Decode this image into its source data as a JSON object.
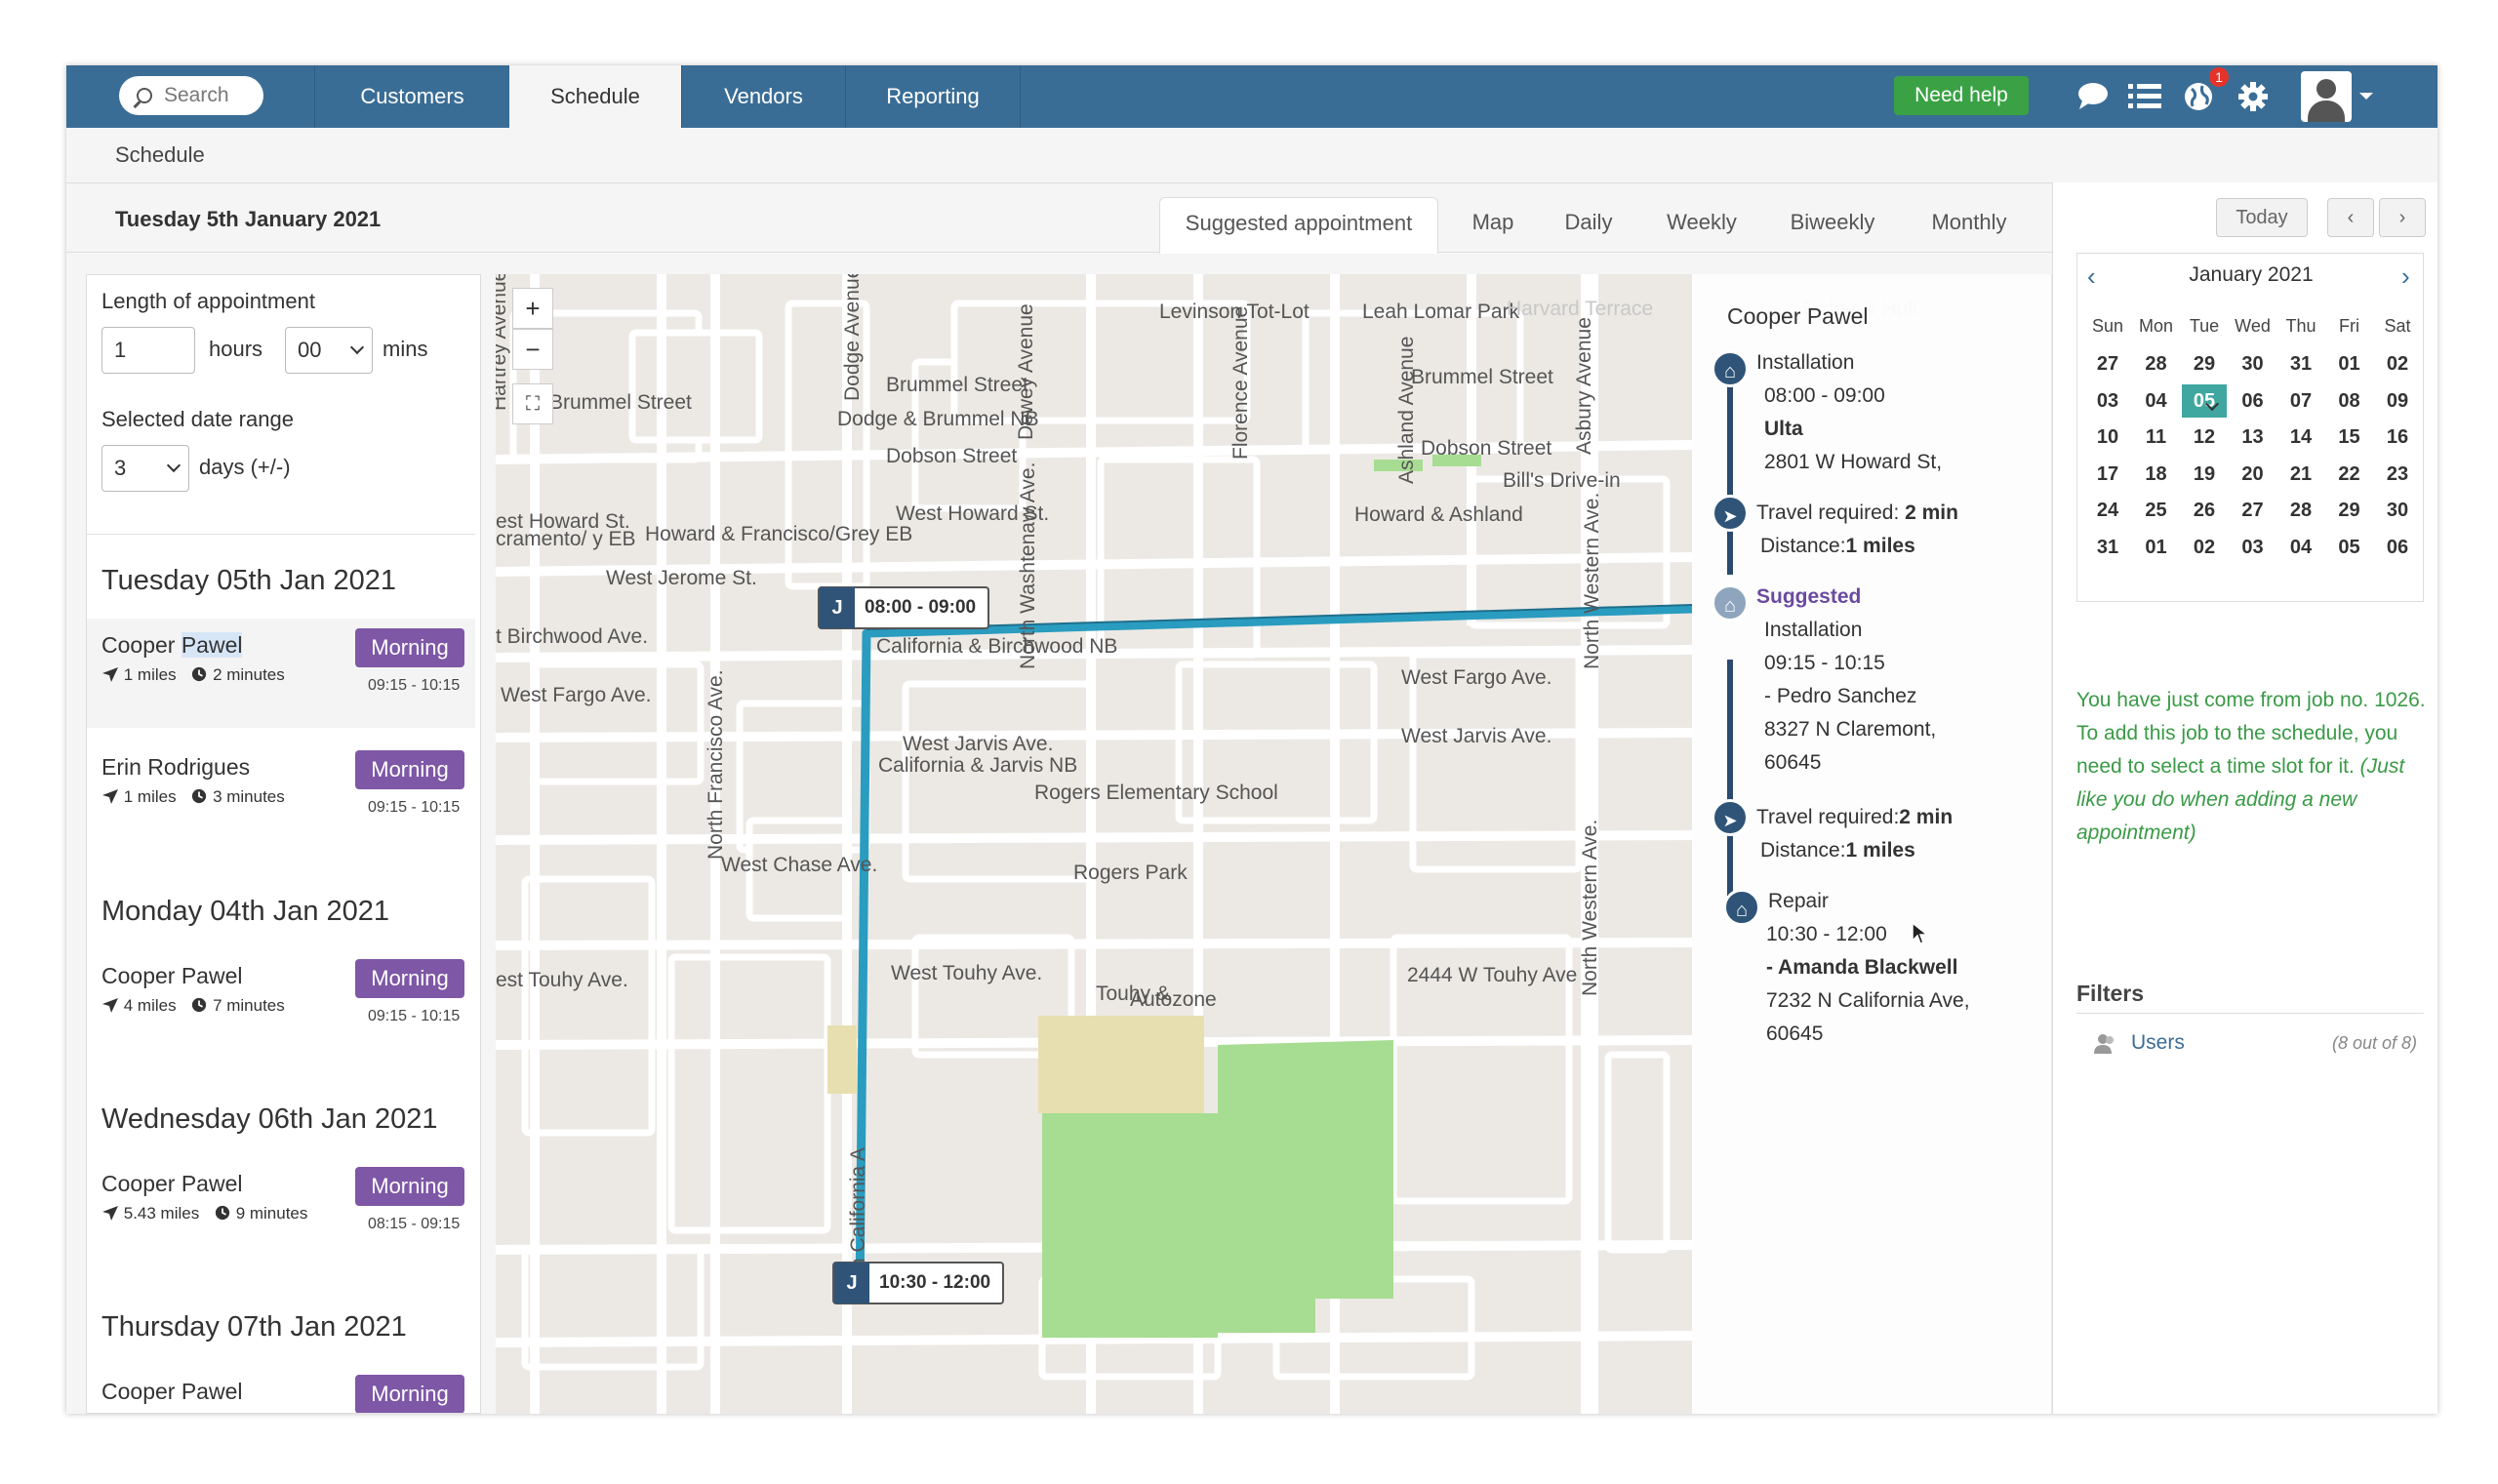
{
  "nav": {
    "search_placeholder": "Search",
    "tabs": [
      {
        "label": "Customers"
      },
      {
        "label": "Schedule"
      },
      {
        "label": "Vendors"
      },
      {
        "label": "Reporting"
      }
    ],
    "help_label": "Need help",
    "notification_count": "1"
  },
  "breadcrumb": "Schedule",
  "header": {
    "date_title": "Tuesday 5th January 2021",
    "view_tabs": [
      "Suggested appointment",
      "Map",
      "Daily",
      "Weekly",
      "Biweekly",
      "Monthly"
    ]
  },
  "form": {
    "length_label": "Length of appointment",
    "hours_value": "1",
    "hours_label": "hours",
    "mins_value": "00",
    "mins_label": "mins",
    "range_label": "Selected date range",
    "range_value": "3",
    "range_suffix": "days (+/-)"
  },
  "days": [
    {
      "title": "Tuesday 05th Jan 2021",
      "slots": [
        {
          "name_first": "Cooper ",
          "name_hi": "Pawel",
          "miles": "1 miles",
          "minutes": "2 minutes",
          "badge": "Morning",
          "time": "09:15 - 10:15"
        },
        {
          "name_first": "Erin Rodrigues",
          "name_hi": "",
          "miles": "1 miles",
          "minutes": "3 minutes",
          "badge": "Morning",
          "time": "09:15 - 10:15"
        }
      ]
    },
    {
      "title": "Monday 04th Jan 2021",
      "slots": [
        {
          "name_first": "Cooper Pawel",
          "name_hi": "",
          "miles": "4 miles",
          "minutes": "7 minutes",
          "badge": "Morning",
          "time": "09:15 - 10:15"
        }
      ]
    },
    {
      "title": "Wednesday 06th Jan 2021",
      "slots": [
        {
          "name_first": "Cooper Pawel",
          "name_hi": "",
          "miles": "5.43 miles",
          "minutes": "9 minutes",
          "badge": "Morning",
          "time": "08:15 - 09:15"
        }
      ]
    },
    {
      "title": "Thursday 07th Jan 2021",
      "slots": [
        {
          "name_first": "Cooper Pawel",
          "name_hi": "",
          "miles": "",
          "minutes": "",
          "badge": "Morning",
          "time": ""
        }
      ]
    }
  ],
  "map": {
    "labels": [
      "Levinson Tot-Lot",
      "Leah Lomar Park",
      "Brummel Street",
      "Brummel Street",
      "Brummel Street",
      "Dodge & Brummel NB",
      "Dobson Street",
      "Dobson Street",
      "Dodge Avenue",
      "Dewey Avenue",
      "Florence Avenue",
      "Ashland Avenue",
      "Asbury Avenue",
      "Hartrey Avenue",
      "Bill's Drive-in",
      "est Howard St.",
      "West Howard St.",
      "Howard & Ashland",
      "Howard & Francisco/Grey EB",
      "cramento/ y EB",
      "West Jerome St.",
      "t Birchwood Ave.",
      "California & Birchwood NB",
      "North Washtenaw Ave.",
      "North Western Ave.",
      "West Fargo Ave.",
      "West Fargo Ave.",
      "West Jarvis Ave.",
      "West Jarvis Ave.",
      "California & Jarvis NB",
      "North Francisco Ave.",
      "Rogers Elementary School",
      "Rogers Park",
      "West Chase Ave.",
      "est Touhy Ave.",
      "West Touhy Ave.",
      "2444 W Touhy Ave",
      "Touhy &",
      "Autozone",
      "h California A",
      "North Western Ave.",
      "Harvard Terrace",
      "Ridge & Hull"
    ],
    "marker1": {
      "letter": "J",
      "time": "08:00 - 09:00"
    },
    "marker2": {
      "letter": "J",
      "time": "10:30 - 12:00"
    }
  },
  "route": {
    "title": "Cooper Pawel",
    "stop1": {
      "type": "Installation",
      "time": "08:00 - 09:00",
      "name": "Ulta",
      "address": "2801 W Howard St,"
    },
    "travel1": {
      "label": "Travel required: ",
      "value": "2 min",
      "dist_label": "Distance:",
      "dist_value": "1 miles"
    },
    "suggested": {
      "label": "Suggested",
      "type": "Installation",
      "time": "09:15 - 10:15",
      "name": "- Pedro Sanchez",
      "address1": "8327 N Claremont,",
      "address2": "60645"
    },
    "travel2": {
      "label": "Travel required:",
      "value": "2 min",
      "dist_label": "Distance:",
      "dist_value": "1 miles"
    },
    "stop3": {
      "type": "Repair",
      "time": "10:30 - 12:00",
      "name": "- Amanda Blackwell",
      "address1": "7232 N California Ave,",
      "address2": "60645"
    }
  },
  "calendar": {
    "today_label": "Today",
    "month": "January 2021",
    "dow": [
      "Sun",
      "Mon",
      "Tue",
      "Wed",
      "Thu",
      "Fri",
      "Sat"
    ],
    "weeks": [
      [
        "27",
        "28",
        "29",
        "30",
        "31",
        "01",
        "02"
      ],
      [
        "03",
        "04",
        "05",
        "06",
        "07",
        "08",
        "09"
      ],
      [
        "10",
        "11",
        "12",
        "13",
        "14",
        "15",
        "16"
      ],
      [
        "17",
        "18",
        "19",
        "20",
        "21",
        "22",
        "23"
      ],
      [
        "24",
        "25",
        "26",
        "27",
        "28",
        "29",
        "30"
      ],
      [
        "31",
        "01",
        "02",
        "03",
        "04",
        "05",
        "06"
      ]
    ],
    "selected": "05"
  },
  "info": {
    "text": "You have just come from job no. 1026. To add this job to the schedule, you need to select a time slot for it. ",
    "italic": "(Just like you do when adding a new appointment)"
  },
  "filters": {
    "title": "Filters",
    "users_label": "Users",
    "users_count": "(8 out of 8)"
  },
  "colors": {
    "nav": "#3a6d96",
    "accent_green": "#3aa245",
    "badge_purple": "#7e57a6",
    "cal_selected": "#3fa7a0",
    "route_line": "#2a9cc0"
  }
}
